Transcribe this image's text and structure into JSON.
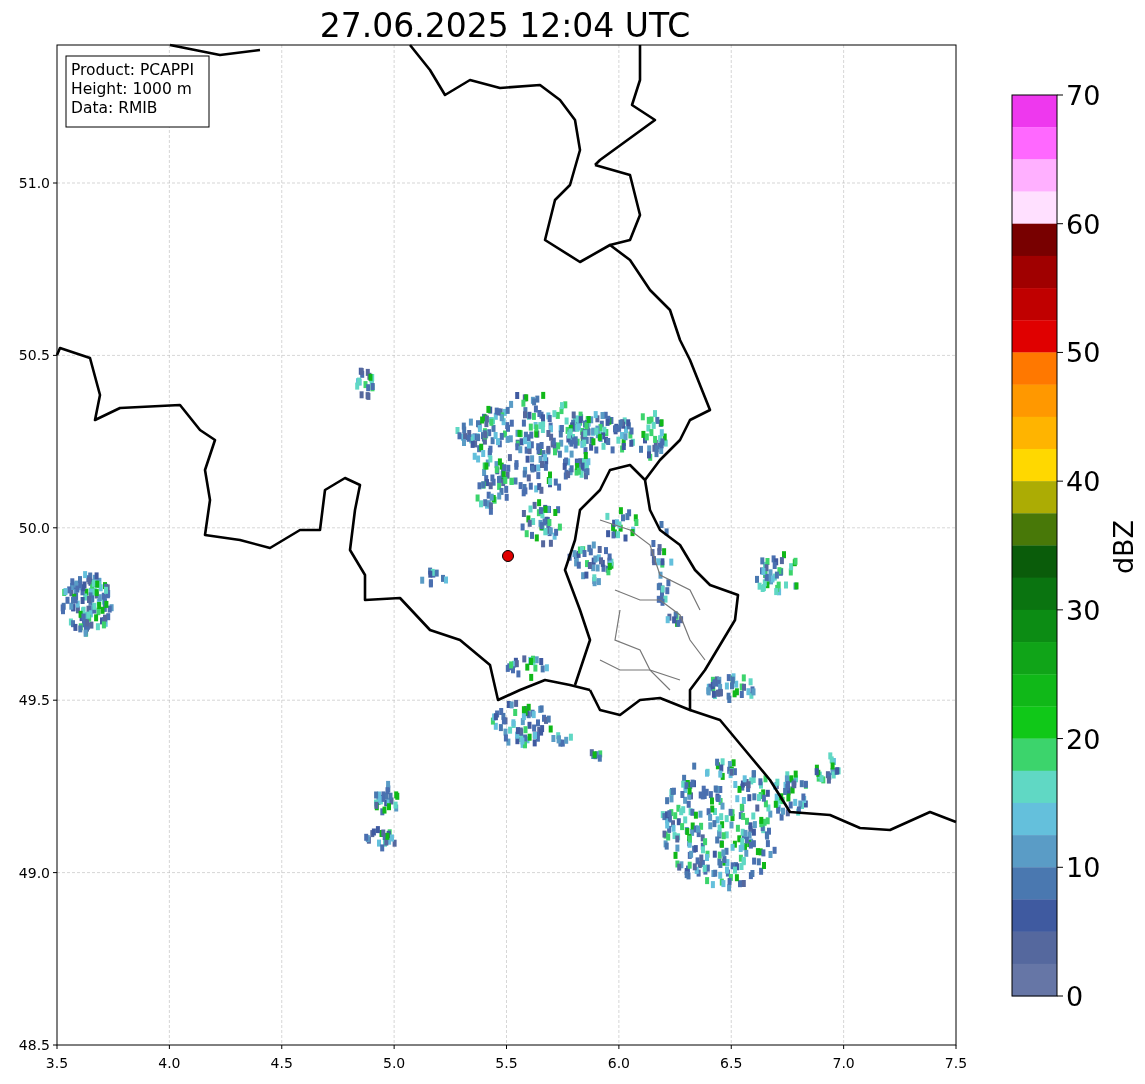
{
  "title": "27.06.2025 12:04 UTC",
  "info_box": [
    "Product: PCAPPI",
    "Height: 1000 m",
    "Data: RMIB"
  ],
  "map": {
    "xticks": [
      "3.5",
      "4.0",
      "4.5",
      "5.0",
      "5.5",
      "6.0",
      "6.5",
      "7.0",
      "7.5"
    ],
    "yticks": [
      "51.0",
      "50.5",
      "50.0",
      "49.5",
      "49.0",
      "48.5"
    ]
  },
  "colorbar": {
    "label": "dBZ",
    "ticks": [
      "70",
      "60",
      "50",
      "40",
      "30",
      "20",
      "10",
      "0"
    ],
    "bands": [
      {
        "color": "#ee38ee"
      },
      {
        "color": "#ff68ff"
      },
      {
        "color": "#ffb0ff"
      },
      {
        "color": "#ffe0ff"
      },
      {
        "color": "#780000"
      },
      {
        "color": "#a00000"
      },
      {
        "color": "#c00000"
      },
      {
        "color": "#e00000"
      },
      {
        "color": "#ff7800"
      },
      {
        "color": "#ff9800"
      },
      {
        "color": "#ffb400"
      },
      {
        "color": "#ffd800"
      },
      {
        "color": "#acac04"
      },
      {
        "color": "#487808"
      },
      {
        "color": "#0a5c0a"
      },
      {
        "color": "#0a7410"
      },
      {
        "color": "#0c8c14"
      },
      {
        "color": "#10a418"
      },
      {
        "color": "#10b818"
      },
      {
        "color": "#10c818"
      },
      {
        "color": "#3cd46c"
      },
      {
        "color": "#60d8c4"
      },
      {
        "color": "#64c0dc"
      },
      {
        "color": "#5a9cc6"
      },
      {
        "color": "#4a78b0"
      },
      {
        "color": "#3f5aa0"
      },
      {
        "color": "#55689e"
      },
      {
        "color": "#6676a6"
      }
    ]
  }
}
